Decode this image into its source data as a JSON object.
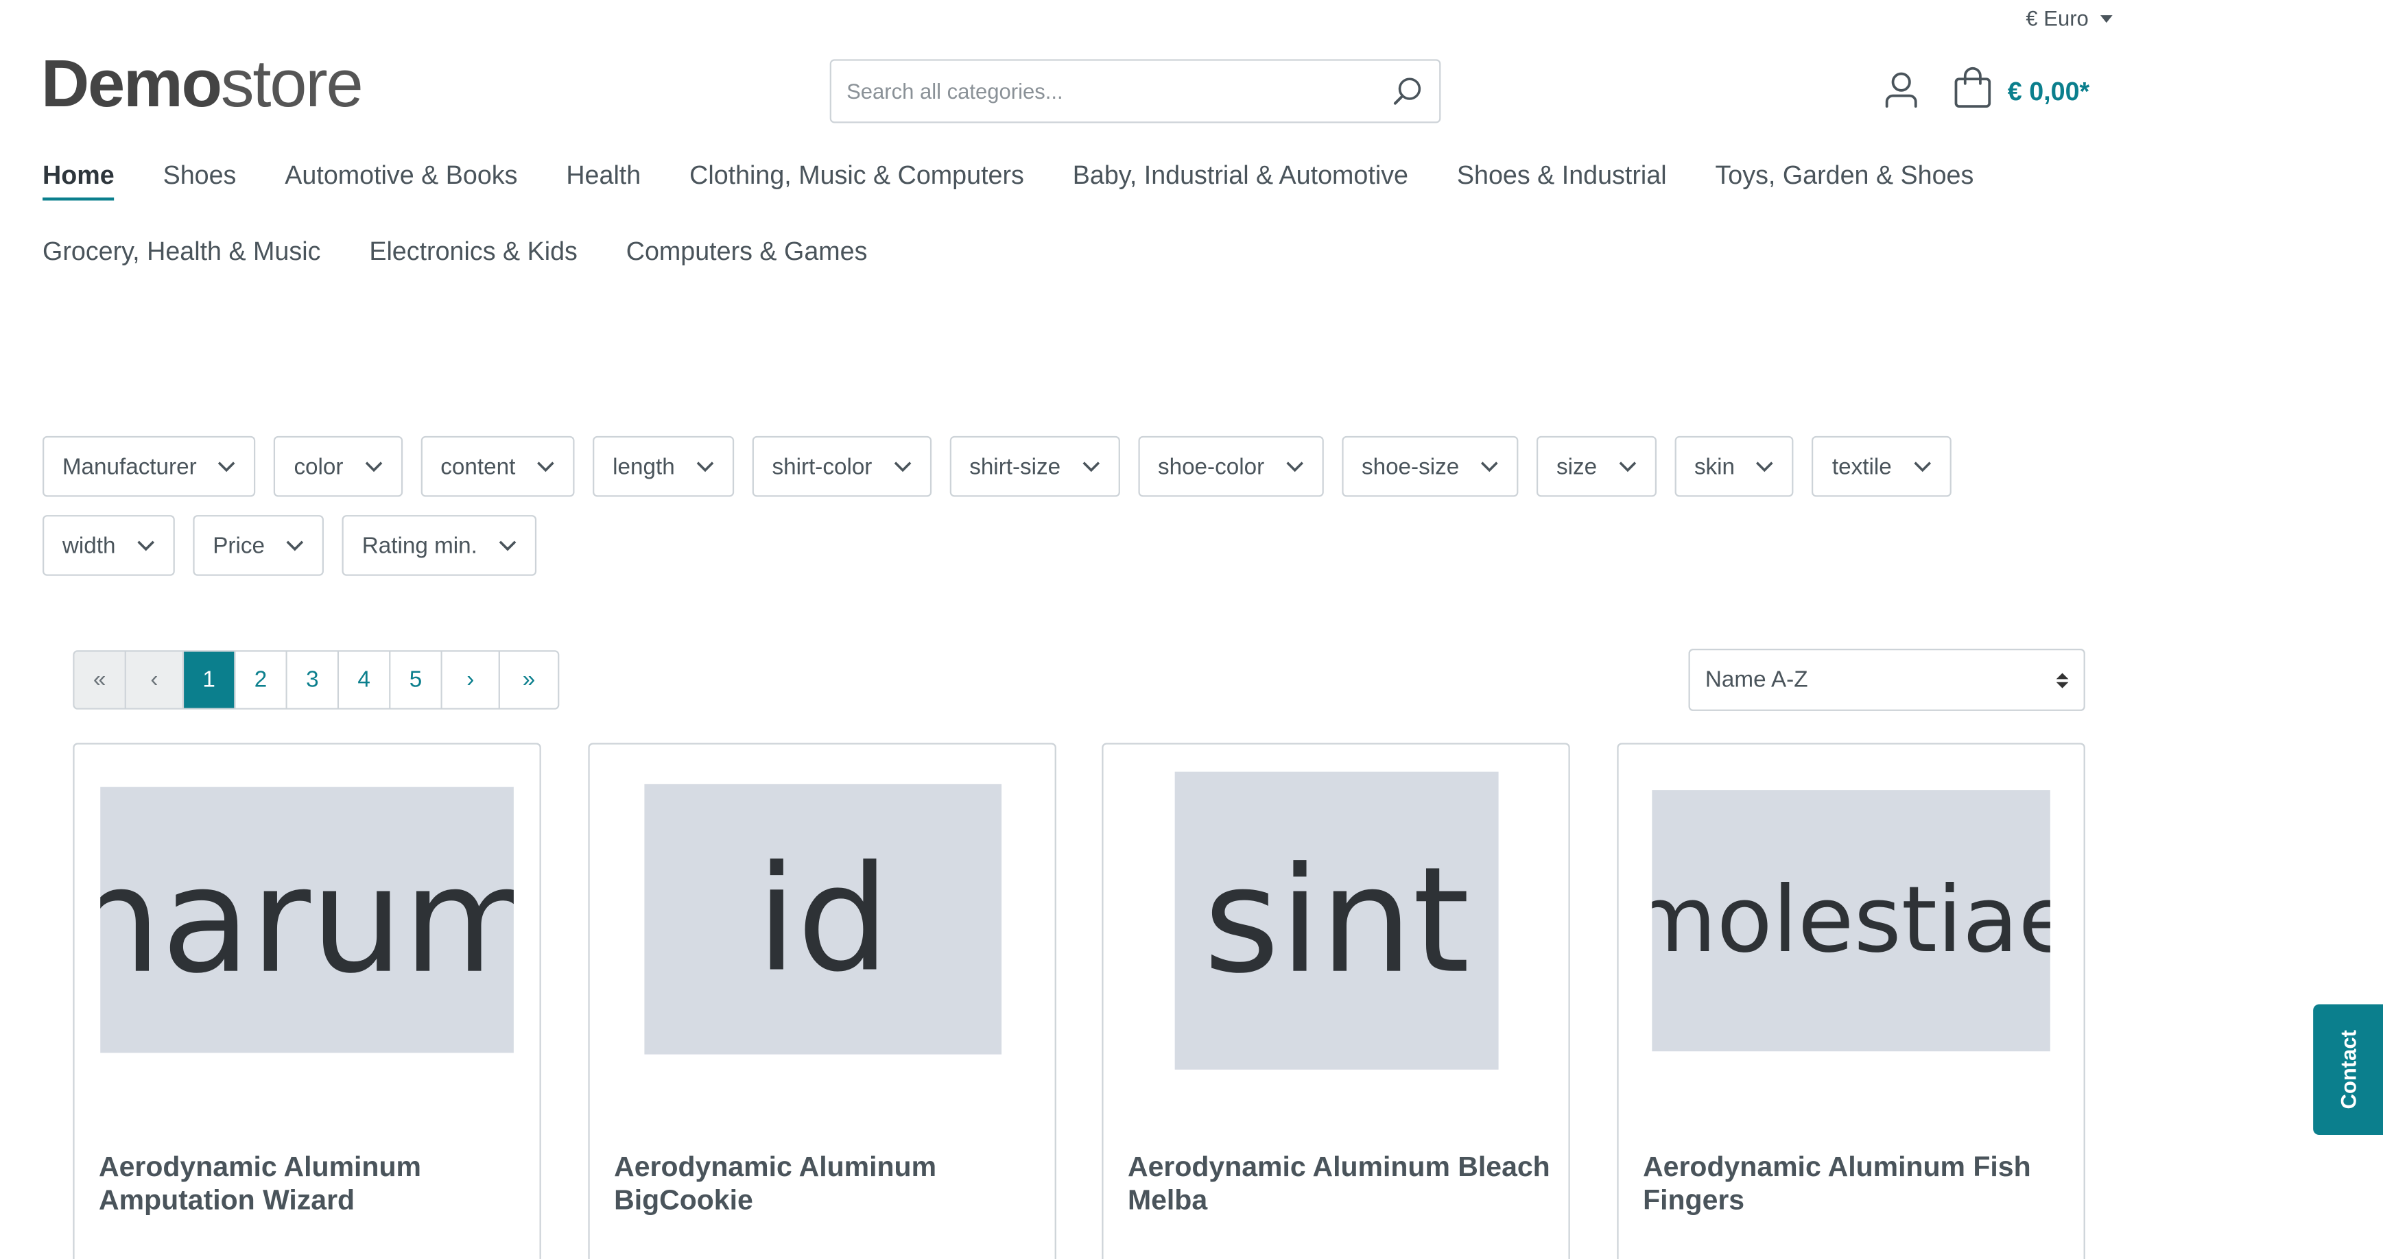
{
  "header": {
    "currency": "€ Euro",
    "logo_bold": "Demo",
    "logo_light": "store",
    "search_placeholder": "Search all categories...",
    "cart_total": "€ 0,00*"
  },
  "nav": {
    "items": [
      "Home",
      "Shoes",
      "Automotive & Books",
      "Health",
      "Clothing, Music & Computers",
      "Baby, Industrial & Automotive",
      "Shoes & Industrial",
      "Toys, Garden & Shoes",
      "Grocery, Health & Music",
      "Electronics & Kids",
      "Computers & Games"
    ],
    "active": "Home"
  },
  "filters": [
    "Manufacturer",
    "color",
    "content",
    "length",
    "shirt-color",
    "shirt-size",
    "shoe-color",
    "shoe-size",
    "size",
    "skin",
    "textile",
    "width",
    "Price",
    "Rating min."
  ],
  "pagination": {
    "first": "«",
    "prev": "‹",
    "pages": [
      "1",
      "2",
      "3",
      "4",
      "5"
    ],
    "current": "1",
    "next": "›",
    "last": "»"
  },
  "sort": {
    "selected": "Name A-Z"
  },
  "products": [
    {
      "image_text": "harum",
      "name": "Aerodynamic Aluminum Amputation Wizard"
    },
    {
      "image_text": "id",
      "name": "Aerodynamic Aluminum BigCookie"
    },
    {
      "image_text": "sint",
      "name": "Aerodynamic Aluminum Bleach Melba"
    },
    {
      "image_text": "molestiae",
      "name": "Aerodynamic Aluminum Fish Fingers"
    }
  ],
  "contact": {
    "label": "Contact"
  },
  "colors": {
    "accent": "#0b7f8d",
    "placeholder_bg": "#d6dbe3",
    "border": "#cdd3d8"
  },
  "icons": [
    "chevron-down-icon",
    "search-icon",
    "account-icon",
    "cart-icon"
  ]
}
